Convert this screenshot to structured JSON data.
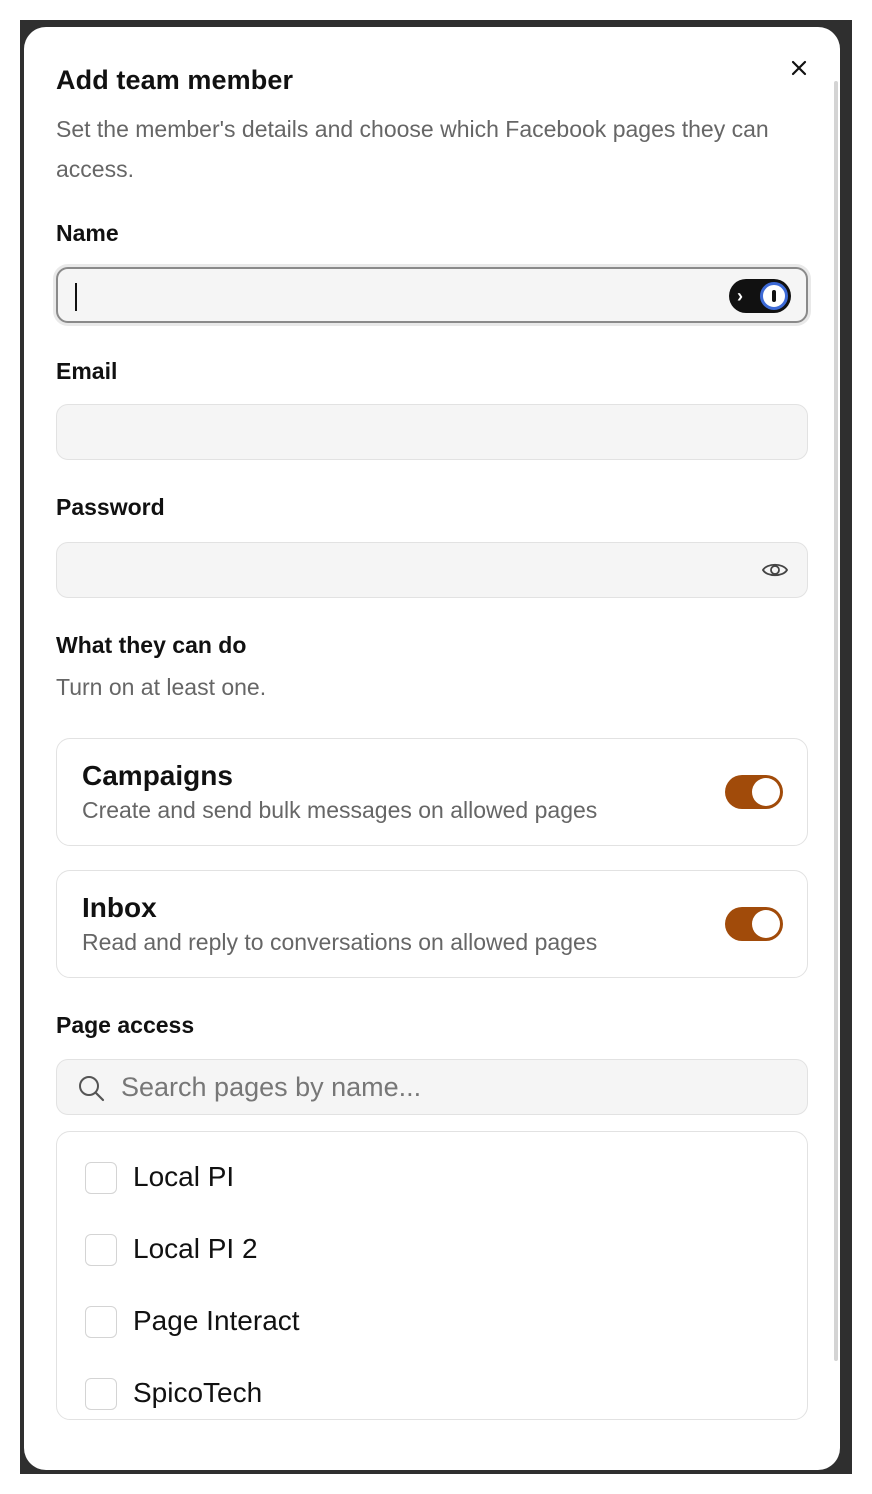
{
  "dialog": {
    "title": "Add team member",
    "subtitle": "Set the member's details and choose which Facebook pages they can access.",
    "close_icon": "close-icon"
  },
  "fields": {
    "name": {
      "label": "Name",
      "value": "",
      "placeholder": ""
    },
    "email": {
      "label": "Email",
      "value": "",
      "placeholder": ""
    },
    "password": {
      "label": "Password",
      "value": "",
      "placeholder": ""
    }
  },
  "permissions": {
    "heading": "What they can do",
    "hint": "Turn on at least one.",
    "items": [
      {
        "title": "Campaigns",
        "description": "Create and send bulk messages on allowed pages",
        "enabled": true
      },
      {
        "title": "Inbox",
        "description": "Read and reply to conversations on allowed pages",
        "enabled": true
      }
    ],
    "toggle_color": "#a14b0a"
  },
  "page_access": {
    "heading": "Page access",
    "search_placeholder": "Search pages by name...",
    "pages": [
      {
        "name": "Local PI",
        "checked": false
      },
      {
        "name": "Local PI 2",
        "checked": false
      },
      {
        "name": "Page Interact",
        "checked": false
      },
      {
        "name": "SpicoTech",
        "checked": false
      }
    ]
  }
}
